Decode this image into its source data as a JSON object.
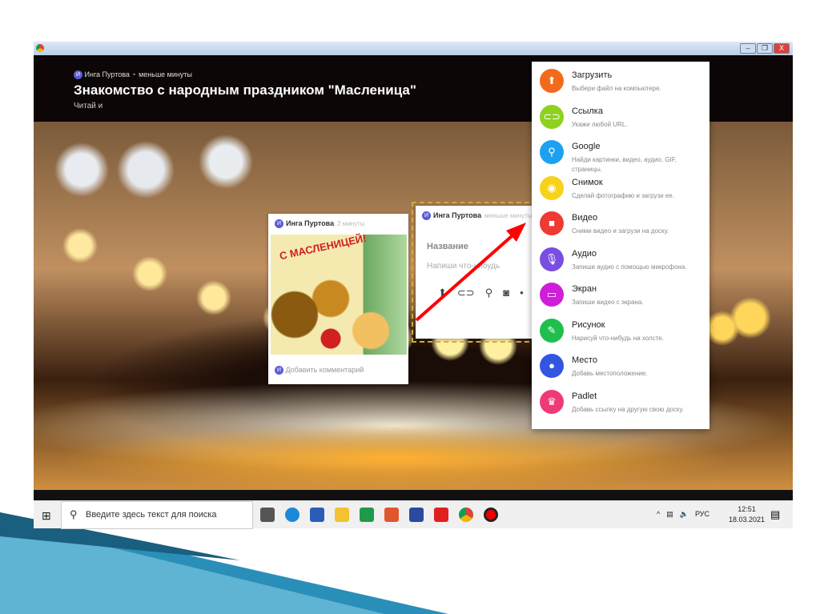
{
  "board": {
    "author": "Инга Пуртова",
    "time": "меньше минуты",
    "title": "Знакомство с народным праздником \"Масленица\"",
    "subtitle": "Читай и"
  },
  "window": {
    "minimize": "–",
    "restore": "❐",
    "close": "X"
  },
  "post1": {
    "author": "Инга Пуртова",
    "time": "2 минуты",
    "image_text": "С МАСЛЕНИЦЕЙ!",
    "comment_placeholder": "Добавить комментарий",
    "avatar": "И"
  },
  "post2": {
    "author": "Инга Пуртова",
    "time": "меньше минуты",
    "title_placeholder": "Название",
    "body_placeholder": "Напиши что-нибудь",
    "avatar": "И"
  },
  "menu": [
    {
      "label": "Загрузить",
      "desc": "Выбери файл на компьютере.",
      "color": "#f26a1b",
      "icon": "upload-icon",
      "glyph": "⬆"
    },
    {
      "label": "Ссылка",
      "desc": "Укажи любой URL.",
      "color": "#8fd11f",
      "icon": "link-icon",
      "glyph": "⊂⊃"
    },
    {
      "label": "Google",
      "desc": "Найди картинки, видео, аудио, GIF, страницы.",
      "color": "#1ea0f0",
      "icon": "search-icon",
      "glyph": "⚲"
    },
    {
      "label": "Снимок",
      "desc": "Сделай фотографию и загрузи ее.",
      "color": "#f7d21a",
      "icon": "camera-icon",
      "glyph": "◉"
    },
    {
      "label": "Видео",
      "desc": "Сними видео и загрузи на доску.",
      "color": "#ee3a32",
      "icon": "video-icon",
      "glyph": "■"
    },
    {
      "label": "Аудио",
      "desc": "Запиши аудио с помощью микрофона.",
      "color": "#7a4ee0",
      "icon": "microphone-icon",
      "glyph": "🎙"
    },
    {
      "label": "Экран",
      "desc": "Запиши видео с экрана.",
      "color": "#cf1ed8",
      "icon": "screen-icon",
      "glyph": "▭"
    },
    {
      "label": "Рисунок",
      "desc": "Нарисуй что-нибудь на холсте.",
      "color": "#1fbf4e",
      "icon": "drawing-icon",
      "glyph": "✎"
    },
    {
      "label": "Место",
      "desc": "Добавь местоположение.",
      "color": "#3256e0",
      "icon": "location-icon",
      "glyph": "●"
    },
    {
      "label": "Padlet",
      "desc": "Добавь ссылку на другую свою доску.",
      "color": "#ee3a78",
      "icon": "padlet-icon",
      "glyph": "♛"
    }
  ],
  "taskbar": {
    "search_placeholder": "Введите здесь текст для поиска",
    "lang": "РУС",
    "time": "12:51",
    "date": "18.03.2021"
  }
}
